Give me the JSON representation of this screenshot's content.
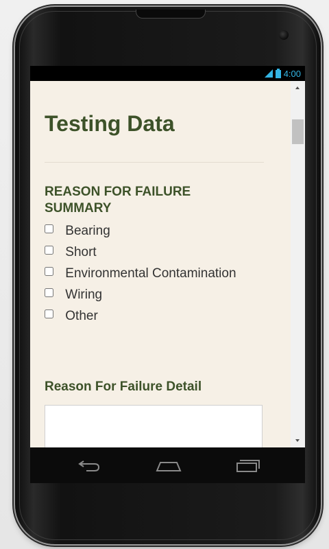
{
  "status_bar": {
    "time": "4:00",
    "signal_icon": "signal-icon",
    "battery_icon": "battery-icon",
    "accent_color": "#33b5e5"
  },
  "page": {
    "title": "Testing Data",
    "title_color": "#3d5229",
    "background_color": "#f6f0e6"
  },
  "failure_summary": {
    "heading": "REASON FOR FAILURE SUMMARY",
    "options": [
      {
        "label": "Bearing",
        "checked": false
      },
      {
        "label": "Short",
        "checked": false
      },
      {
        "label": "Environmental Contamination",
        "checked": false
      },
      {
        "label": "Wiring",
        "checked": false
      },
      {
        "label": "Other",
        "checked": false
      }
    ]
  },
  "failure_detail": {
    "label": "Reason For Failure Detail",
    "value": ""
  },
  "navigation": {
    "back_icon": "back-icon",
    "home_icon": "home-icon",
    "recents_icon": "recent-apps-icon"
  }
}
